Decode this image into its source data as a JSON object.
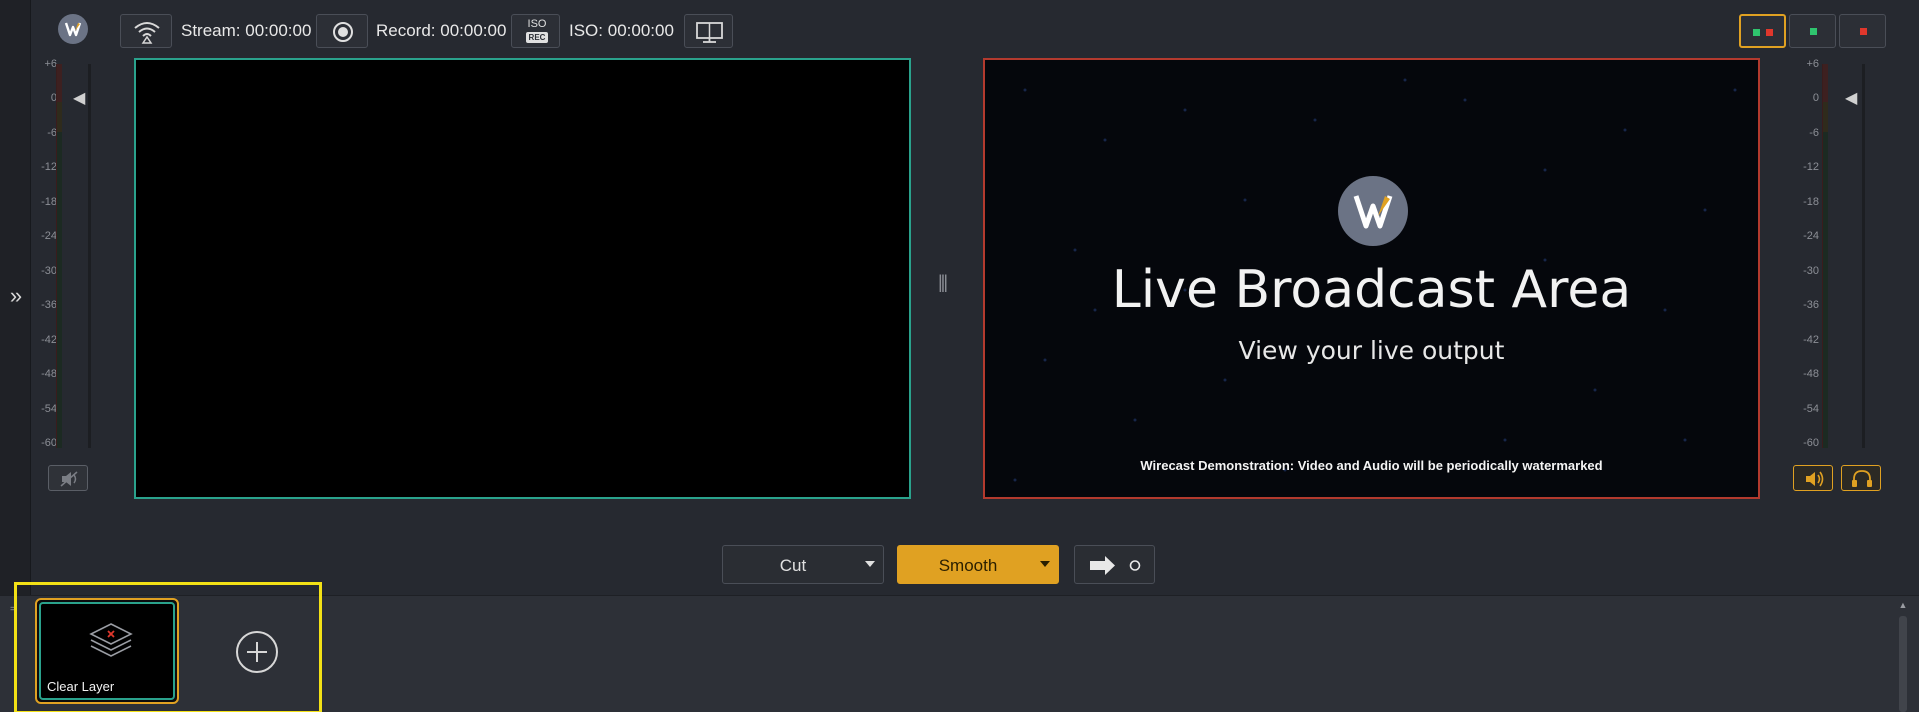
{
  "toolbar": {
    "stream_label": "Stream:",
    "stream_time": "00:00:00",
    "record_label": "Record:",
    "record_time": "00:00:00",
    "iso_badge_top": "ISO",
    "iso_badge_bottom": "REC",
    "iso_label": "ISO:",
    "iso_time": "00:00:00",
    "layouts": [
      "preview-and-live",
      "live-only",
      "preview-only"
    ],
    "active_layout": 0
  },
  "meters": {
    "ticks": [
      "+6",
      "0",
      "-6",
      "-12",
      "-18",
      "-24",
      "-30",
      "-36",
      "-42",
      "-48",
      "-54",
      "-60"
    ]
  },
  "live": {
    "title": "Live Broadcast Area",
    "subtitle": "View your live output",
    "watermark": "Wirecast Demonstration: Video and Audio will be periodically watermarked"
  },
  "transitions": {
    "cut_label": "Cut",
    "smooth_label": "Smooth"
  },
  "shots": [
    {
      "label": "Clear Layer"
    }
  ],
  "colors": {
    "accent": "#e0a122",
    "preview_border": "#2aa28c",
    "live_border": "#b33a2e",
    "highlight": "#f3e116"
  }
}
